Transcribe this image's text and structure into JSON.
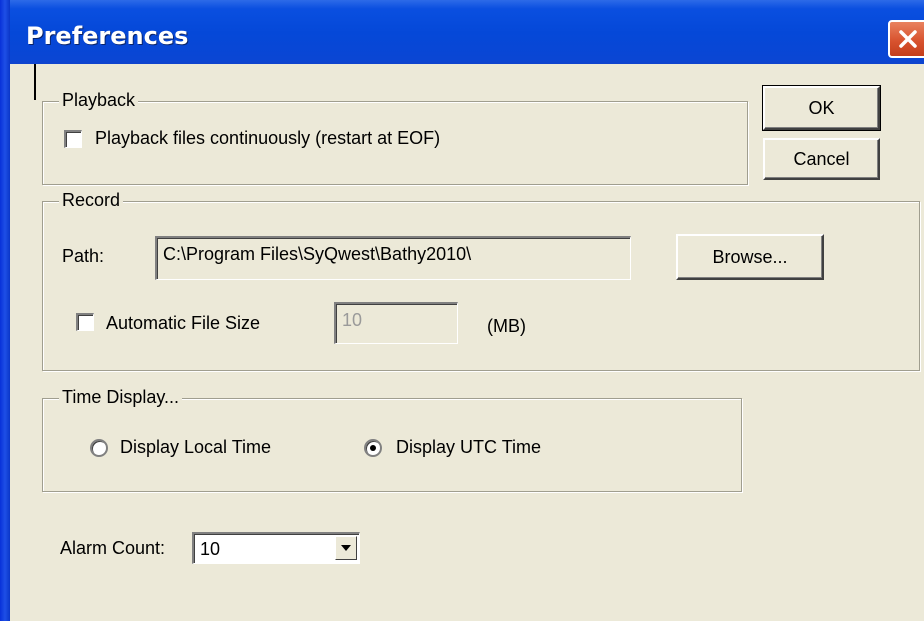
{
  "window": {
    "title": "Preferences"
  },
  "playback": {
    "group_label": "Playback",
    "continuous_label": "Playback files continuously (restart at EOF)",
    "continuous_checked": false
  },
  "buttons": {
    "ok": "OK",
    "cancel": "Cancel",
    "browse": "Browse..."
  },
  "record": {
    "group_label": "Record",
    "path_label": "Path:",
    "path_value": "C:\\Program Files\\SyQwest\\Bathy2010\\",
    "auto_size_label": "Automatic File Size",
    "auto_size_checked": false,
    "file_size_value": "10",
    "file_size_unit": "(MB)"
  },
  "time_display": {
    "group_label": "Time Display...",
    "local_label": "Display Local Time",
    "utc_label": "Display UTC Time",
    "selected": "utc"
  },
  "alarm": {
    "label": "Alarm Count:",
    "value": "10"
  },
  "icons": {
    "close": "close-icon",
    "dropdown": "chevron-down-icon"
  },
  "colors": {
    "titlebar": "#0548d8",
    "close_button": "#d8532f",
    "dialog_bg": "#ece9d8"
  }
}
